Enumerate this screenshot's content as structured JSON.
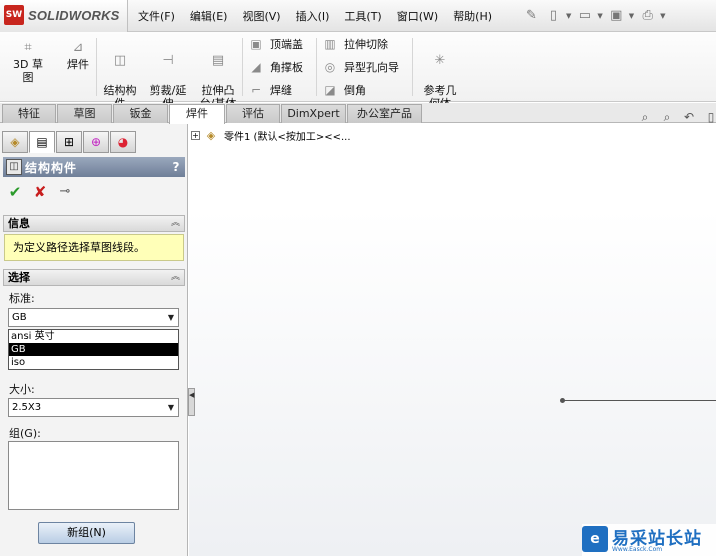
{
  "app": {
    "logo_mark": "SW",
    "logo_text": "SOLIDWORKS",
    "menu": [
      "文件(F)",
      "编辑(E)",
      "视图(V)",
      "插入(I)",
      "工具(T)",
      "窗口(W)",
      "帮助(H)"
    ]
  },
  "ribbon": {
    "big_buttons": [
      {
        "label": "3D 草图",
        "icon": "sketch-3d-icon"
      },
      {
        "label": "焊件",
        "icon": "weldment-icon"
      },
      {
        "label": "结构构\n件",
        "icon": "structural-member-icon"
      },
      {
        "label": "剪裁/延\n伸",
        "icon": "trim-extend-icon"
      },
      {
        "label": "拉伸凸\n台/基体",
        "icon": "extrude-boss-icon"
      }
    ],
    "small_buttons": [
      {
        "label": "顶端盖",
        "icon": "end-cap-icon"
      },
      {
        "label": "角撑板",
        "icon": "gusset-icon"
      },
      {
        "label": "焊缝",
        "icon": "weld-bead-icon"
      },
      {
        "label": "拉伸切除",
        "icon": "extrude-cut-icon"
      },
      {
        "label": "异型孔向导",
        "icon": "hole-wizard-icon"
      },
      {
        "label": "倒角",
        "icon": "chamfer-icon"
      }
    ],
    "ref_geometry": "参考几\n何体"
  },
  "tabs": [
    "特征",
    "草图",
    "钣金",
    "焊件",
    "评估",
    "DimXpert",
    "办公室产品"
  ],
  "active_tab": "焊件",
  "property_manager": {
    "title": "结构构件",
    "help": "?",
    "info_header": "信息",
    "info_text": "为定义路径选择草图线段。",
    "selection_header": "选择",
    "standard_label": "标准:",
    "standard_value": "GB",
    "standard_options": [
      "ansi 英寸",
      "GB",
      "iso"
    ],
    "standard_selected": "GB",
    "size_label": "大小:",
    "size_value": "2.5X3",
    "group_label": "组(G):",
    "new_group_button": "新组(N)"
  },
  "tree": {
    "item": "零件1 (默认<按加工><<..."
  },
  "watermark": {
    "text": "易采站长站",
    "url": "Www.Easck.Com"
  }
}
